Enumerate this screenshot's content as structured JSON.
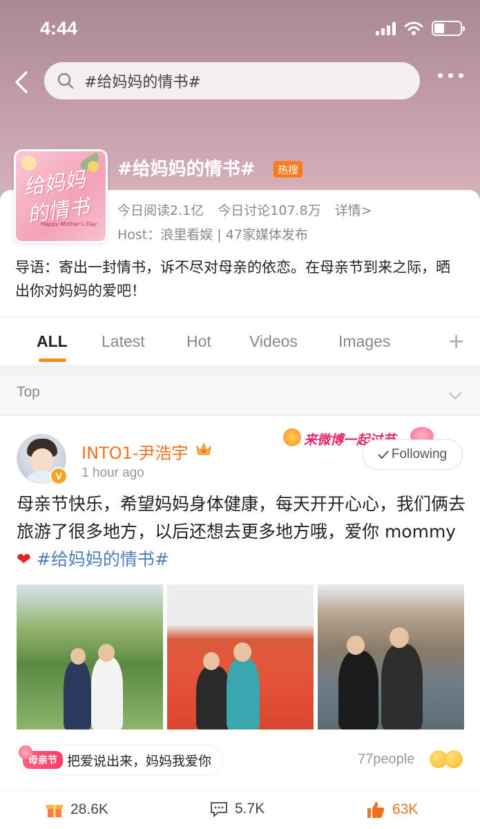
{
  "status_bar": {
    "time": "4:44"
  },
  "search": {
    "query": "#给妈妈的情书#"
  },
  "topic": {
    "title": "#给妈妈的情书#",
    "badge": "热搜",
    "reads": "今日阅读2.1亿",
    "discussions": "今日讨论107.8万",
    "details": "详情>",
    "host": "Host：浪里看娱 | 47家媒体发布",
    "guide": "导语：寄出一封情书，诉不尽对母亲的依恋。在母亲节到来之际，晒出你对妈妈的爱吧！",
    "cover_text": "给妈妈的情书",
    "cover_caption": "Happy Mother's Day"
  },
  "tabs": [
    {
      "label": "ALL",
      "active": true
    },
    {
      "label": "Latest",
      "active": false
    },
    {
      "label": "Hot",
      "active": false
    },
    {
      "label": "Videos",
      "active": false
    },
    {
      "label": "Images",
      "active": false
    }
  ],
  "tab_plus": "+",
  "section": {
    "top_label": "Top"
  },
  "post": {
    "username": "INTO1-尹浩宇",
    "verified_mark": "V",
    "time": "1 hour ago",
    "event_banner": "来微博一起过节",
    "follow_label": "Following",
    "text_main": "母亲节快乐，希望妈妈身体健康，每天开开心心，我们俩去旅游了很多地方，以后还想去更多地方哦，爱你 mommy",
    "heart": "❤",
    "hashtag": "#给妈妈的情书#",
    "tag_chip": "母亲节",
    "tag_text": "把爱说出来，妈妈我爱你",
    "people": "77people",
    "reposts": "28.6K",
    "comments": "5.7K",
    "likes": "63K"
  },
  "colors": {
    "accent_orange": "#f0721c",
    "tab_underline": "#ff8a1c",
    "hashtag_blue": "#4a7fbf",
    "hot_badge": "#ff7a1a"
  }
}
